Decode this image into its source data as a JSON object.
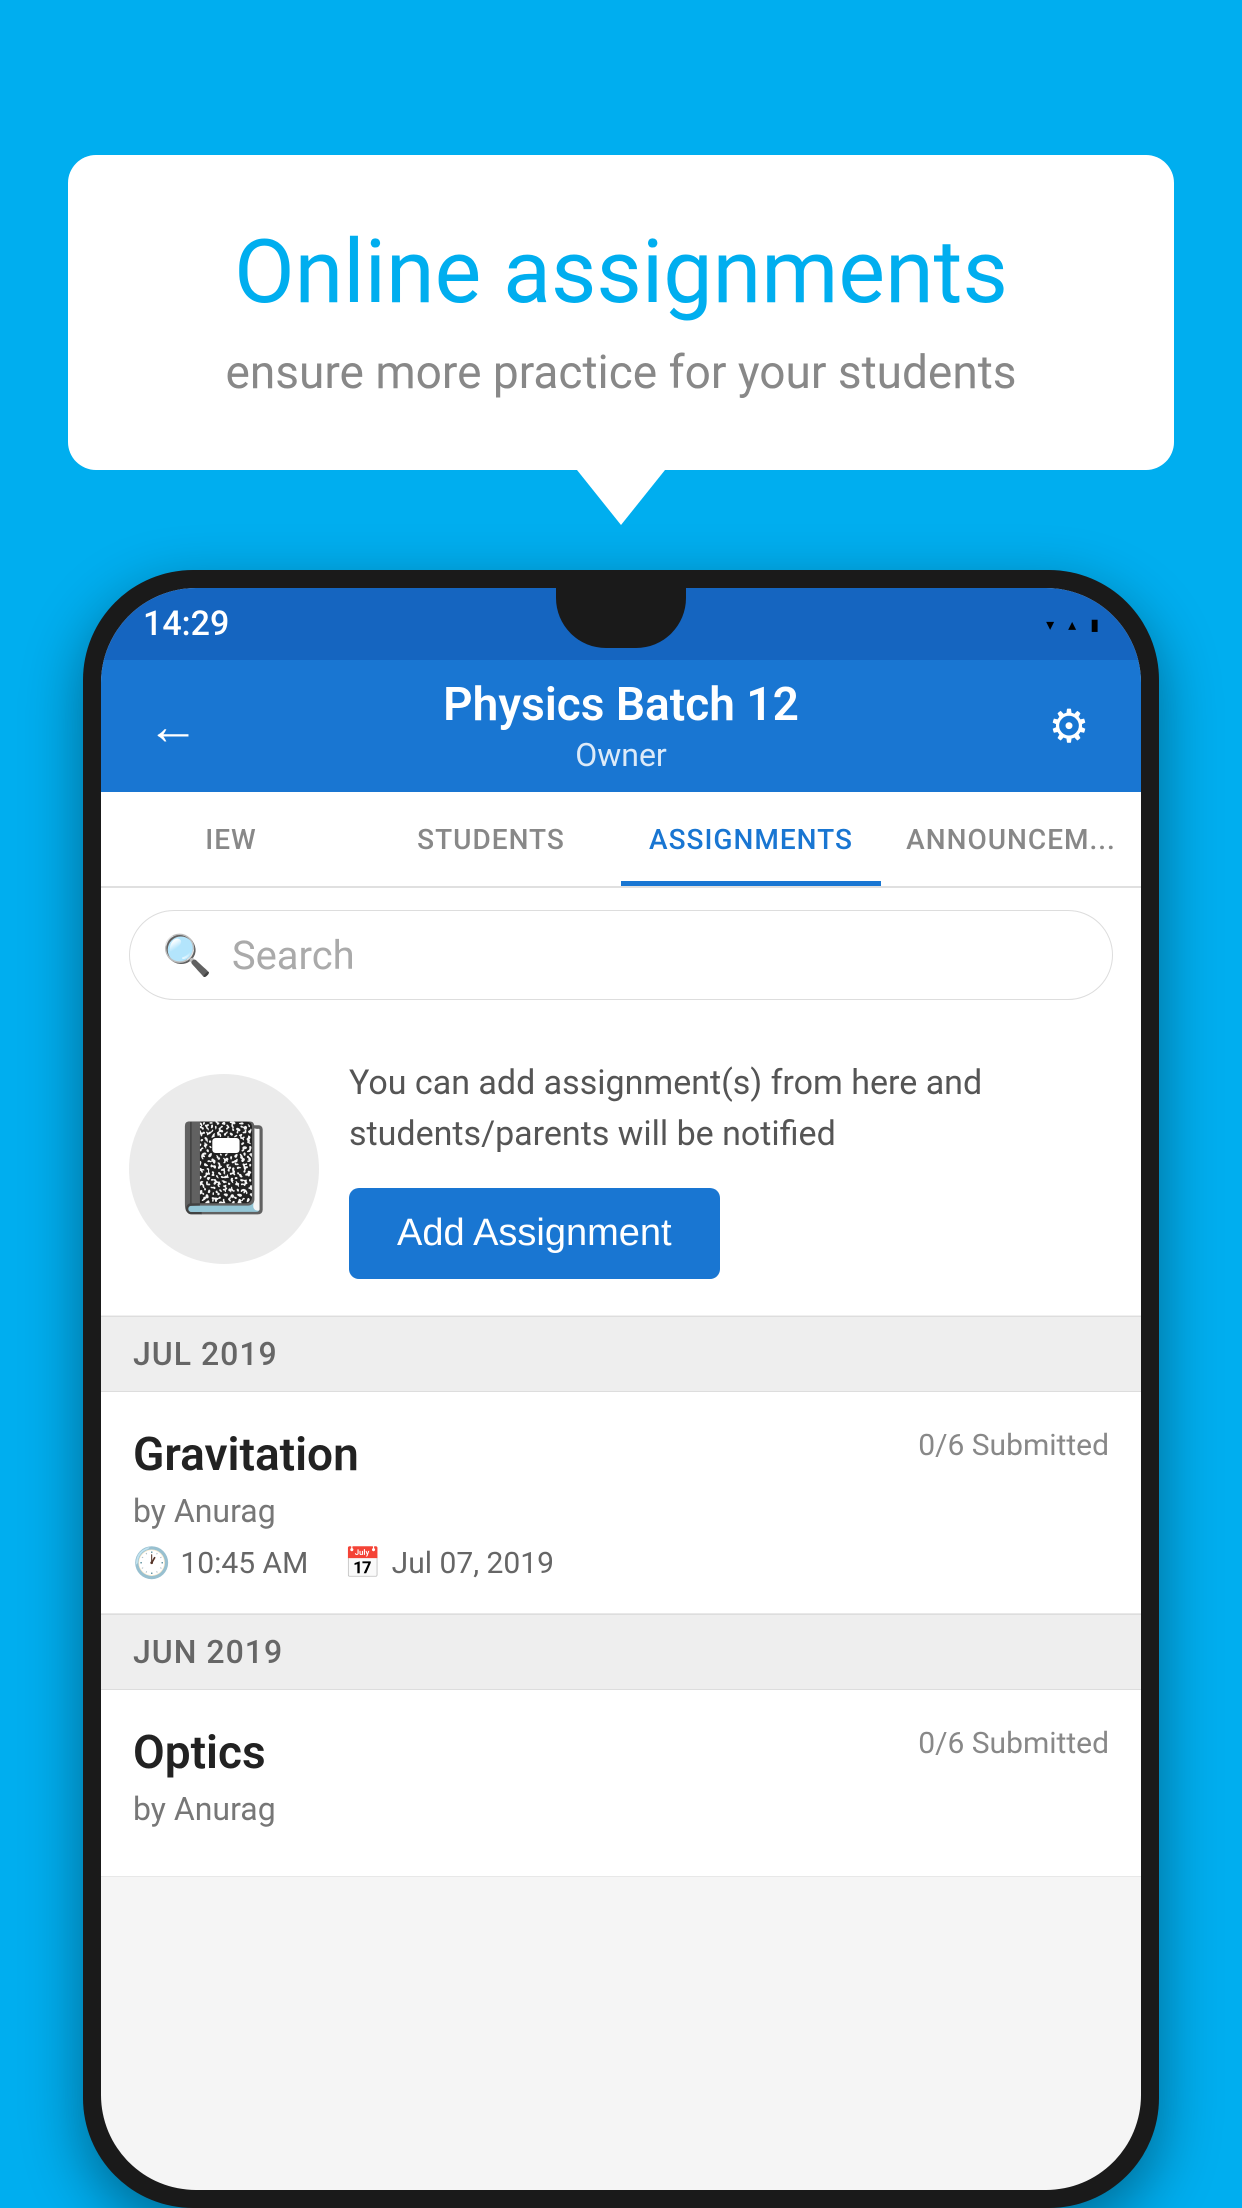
{
  "background_color": "#00AEEF",
  "speech_bubble": {
    "title": "Online assignments",
    "subtitle": "ensure more practice for your students"
  },
  "status_bar": {
    "time": "14:29",
    "icons": [
      "wifi",
      "signal",
      "battery"
    ]
  },
  "app_bar": {
    "back_label": "←",
    "title": "Physics Batch 12",
    "subtitle": "Owner",
    "settings_label": "⚙"
  },
  "tabs": [
    {
      "id": "iew",
      "label": "IEW",
      "active": false
    },
    {
      "id": "students",
      "label": "STUDENTS",
      "active": false
    },
    {
      "id": "assignments",
      "label": "ASSIGNMENTS",
      "active": true
    },
    {
      "id": "announcements",
      "label": "ANNOUNCEM...",
      "active": false
    }
  ],
  "search": {
    "placeholder": "Search"
  },
  "add_assignment_card": {
    "description": "You can add assignment(s) from here and students/parents will be notified",
    "button_label": "Add Assignment"
  },
  "sections": [
    {
      "header": "JUL 2019",
      "assignments": [
        {
          "name": "Gravitation",
          "submitted": "0/6 Submitted",
          "author": "by Anurag",
          "time": "10:45 AM",
          "date": "Jul 07, 2019"
        }
      ]
    },
    {
      "header": "JUN 2019",
      "assignments": [
        {
          "name": "Optics",
          "submitted": "0/6 Submitted",
          "author": "by Anurag",
          "time": "",
          "date": ""
        }
      ]
    }
  ]
}
